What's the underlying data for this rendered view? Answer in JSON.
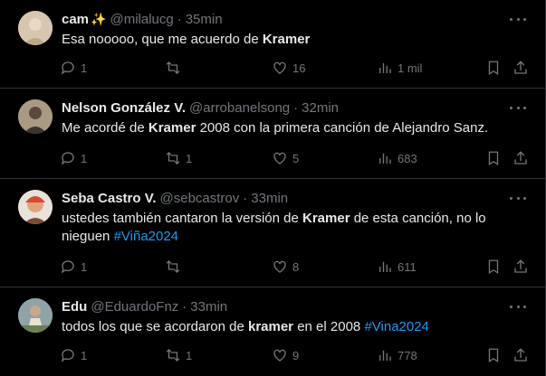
{
  "tweets": [
    {
      "name": "cam",
      "sparkle": "✨",
      "handle": "@milalucg",
      "time": "35min",
      "text_parts": [
        "Esa nooooo, que me acuerdo de ",
        "Kramer",
        ""
      ],
      "hashtag": "",
      "replies": "1",
      "retweets": "",
      "likes": "16",
      "views": "1 mil",
      "avatar_color": "#c9b59a"
    },
    {
      "name": "Nelson González V.",
      "sparkle": "",
      "handle": "@arrobanelsong",
      "time": "32min",
      "text_parts": [
        "Me acordé de ",
        "Kramer",
        " 2008 con la primera canción de Alejandro Sanz."
      ],
      "hashtag": "",
      "replies": "1",
      "retweets": "1",
      "likes": "5",
      "views": "683",
      "avatar_color": "#8a7d6a"
    },
    {
      "name": "Seba Castro V.",
      "sparkle": "",
      "handle": "@sebcastrov",
      "time": "33min",
      "text_parts": [
        "ustedes también cantaron la versión de ",
        "Kramer",
        " de esta canción, no lo nieguen  "
      ],
      "hashtag": "#Viña2024",
      "replies": "1",
      "retweets": "",
      "likes": "8",
      "views": "611",
      "avatar_color": "#d9573b"
    },
    {
      "name": "Edu",
      "sparkle": "",
      "handle": "@EduardoFnz",
      "time": "33min",
      "text_parts": [
        "todos los que se acordaron de ",
        "kramer",
        " en el 2008  "
      ],
      "hashtag": "#Vina2024",
      "replies": "1",
      "retweets": "1",
      "likes": "9",
      "views": "778",
      "avatar_color": "#9aa7a0"
    }
  ],
  "colors": {
    "background": "#000000",
    "text": "#e7e9ea",
    "muted": "#71767b",
    "link": "#1d9bf0",
    "divider": "#2f3336"
  }
}
